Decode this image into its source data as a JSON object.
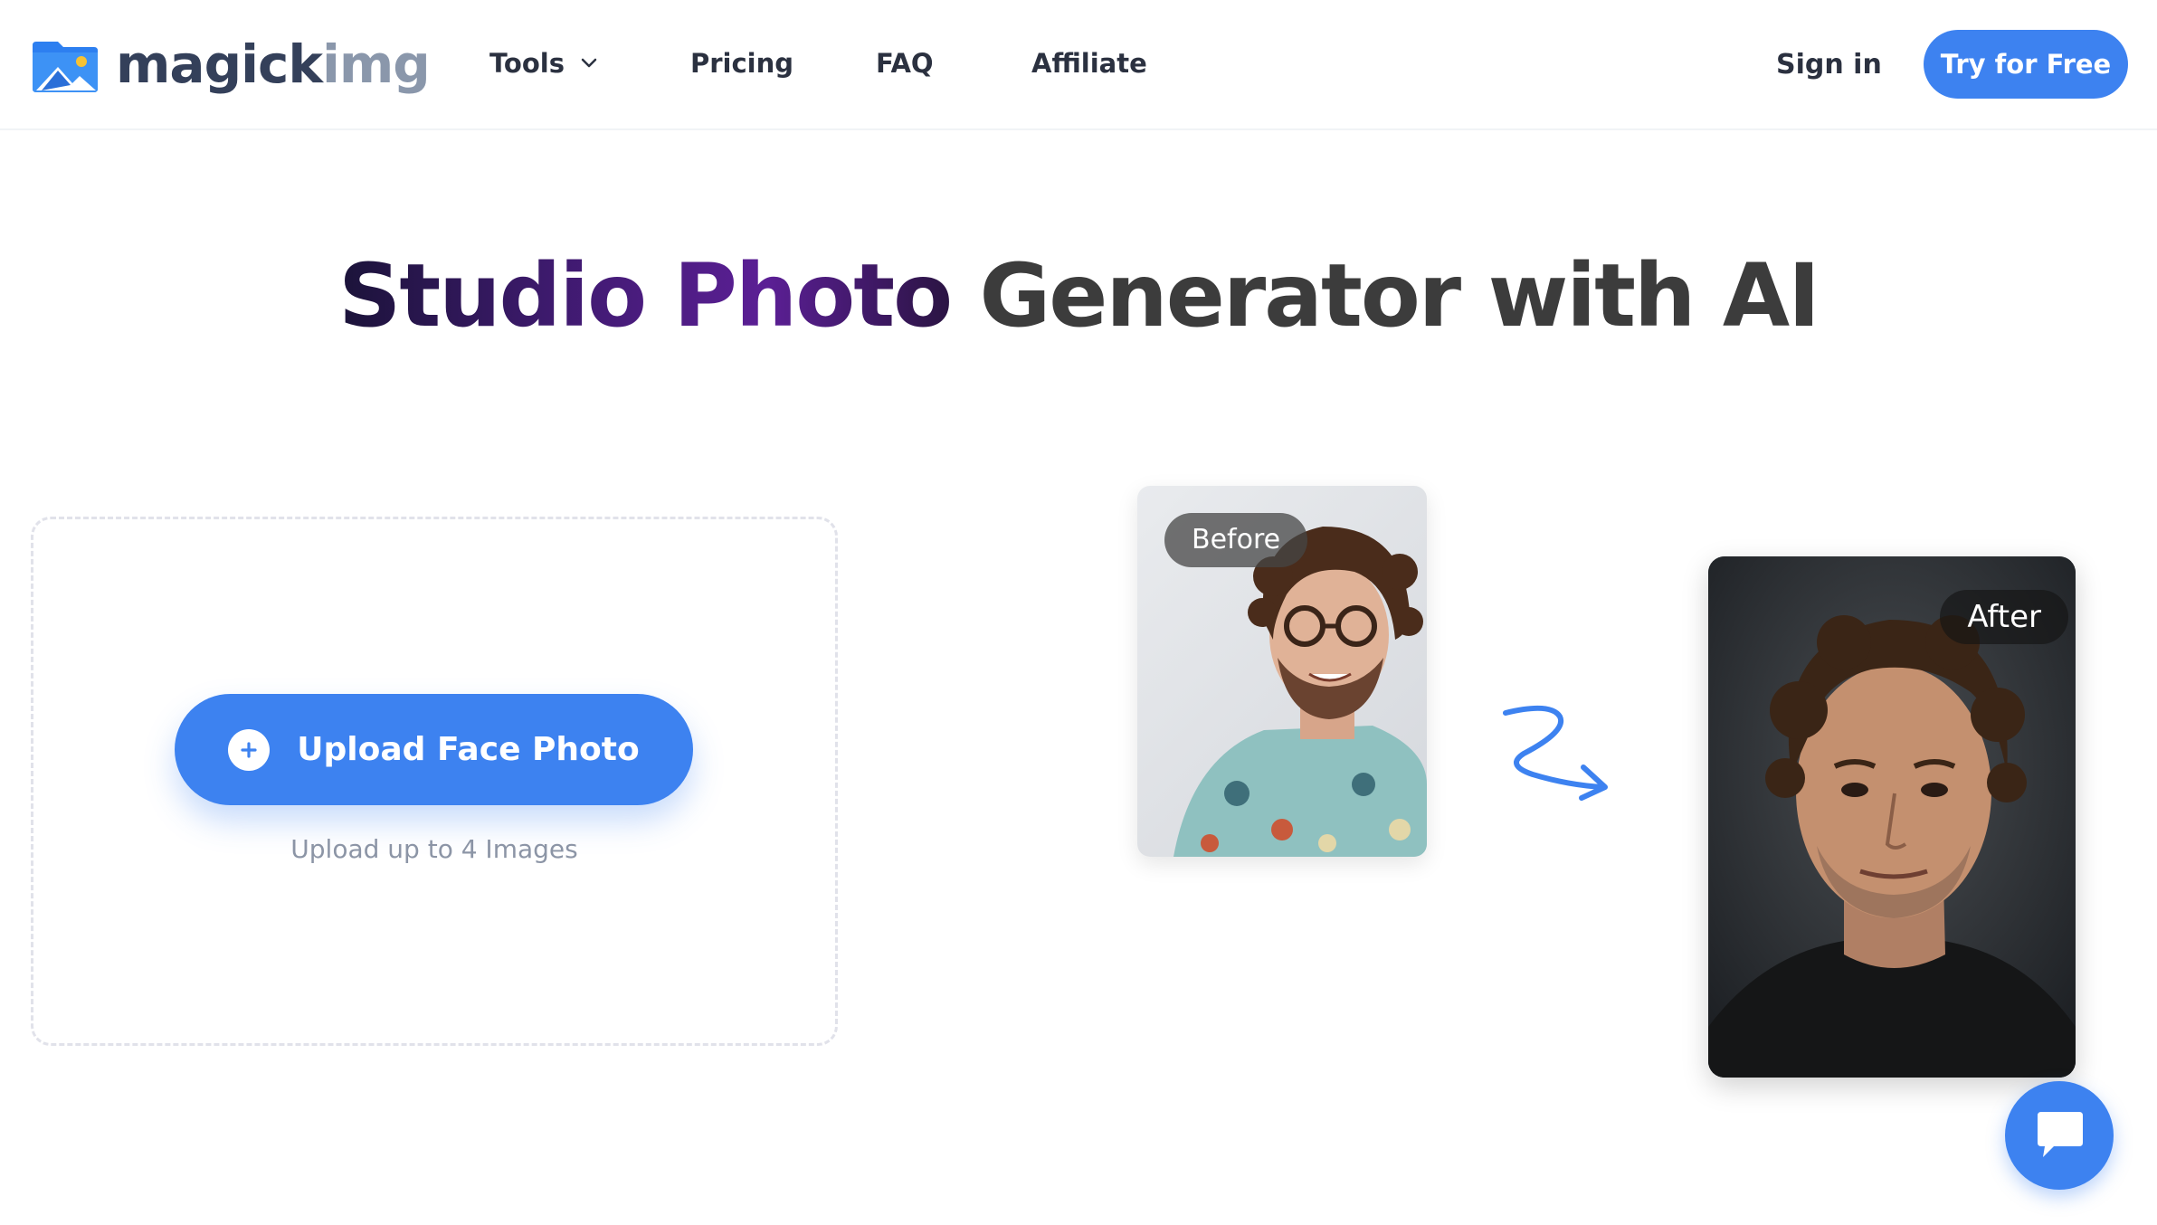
{
  "brand": {
    "logo_part1": "magick",
    "logo_part2": "img",
    "accent_color": "#3d82f0"
  },
  "nav": {
    "tools": "Tools",
    "pricing": "Pricing",
    "faq": "FAQ",
    "affiliate": "Affiliate",
    "sign_in": "Sign in",
    "cta": "Try for Free"
  },
  "hero": {
    "title_highlight": "Studio Photo",
    "title_rest": " Generator with AI"
  },
  "upload": {
    "button_label": "Upload Face Photo",
    "hint": "Upload up to 4 Images"
  },
  "demo": {
    "before_label": "Before",
    "after_label": "After"
  },
  "icons": [
    "logo-mark-icon",
    "chevron-down-icon",
    "plus-icon",
    "squiggle-arrow-icon",
    "chat-icon"
  ]
}
